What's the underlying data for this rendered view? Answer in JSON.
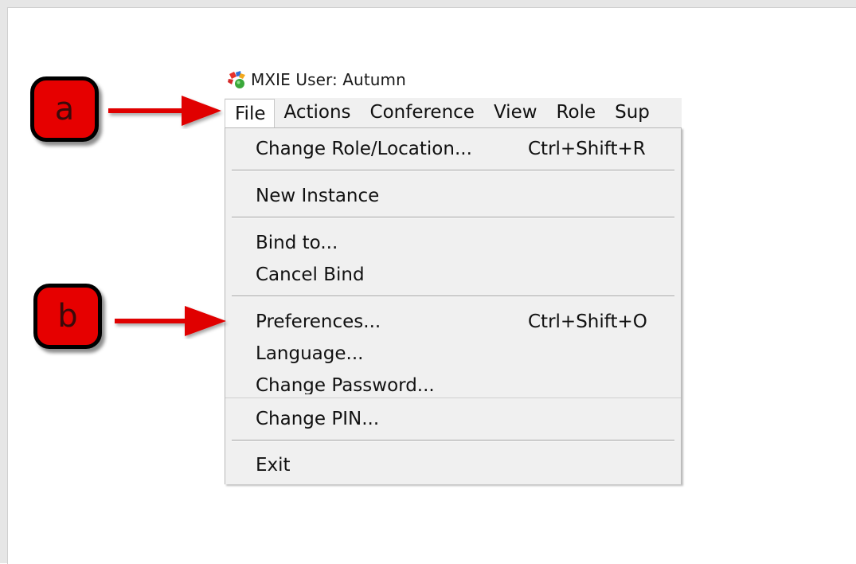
{
  "window": {
    "title": "MXIE User: Autumn",
    "icon": "mxie-app-icon"
  },
  "menubar": {
    "items": [
      {
        "label": "File"
      },
      {
        "label": "Actions"
      },
      {
        "label": "Conference"
      },
      {
        "label": "View"
      },
      {
        "label": "Role"
      },
      {
        "label": "Sup"
      }
    ]
  },
  "file_menu": {
    "change_role": {
      "label": "Change Role/Location...",
      "shortcut": "Ctrl+Shift+R"
    },
    "new_instance": {
      "label": "New Instance"
    },
    "bind_to": {
      "label": "Bind to..."
    },
    "cancel_bind": {
      "label": "Cancel Bind"
    },
    "preferences": {
      "label": "Preferences...",
      "shortcut": "Ctrl+Shift+O"
    },
    "language": {
      "label": "Language..."
    },
    "change_password": {
      "label": "Change Password..."
    },
    "change_pin": {
      "label": "Change PIN..."
    },
    "exit": {
      "label": "Exit"
    }
  },
  "callouts": {
    "a": "a",
    "b": "b"
  },
  "colors": {
    "callout_fill": "#e60000",
    "arrow": "#e00000",
    "menu_bg": "#f0f0f0"
  }
}
